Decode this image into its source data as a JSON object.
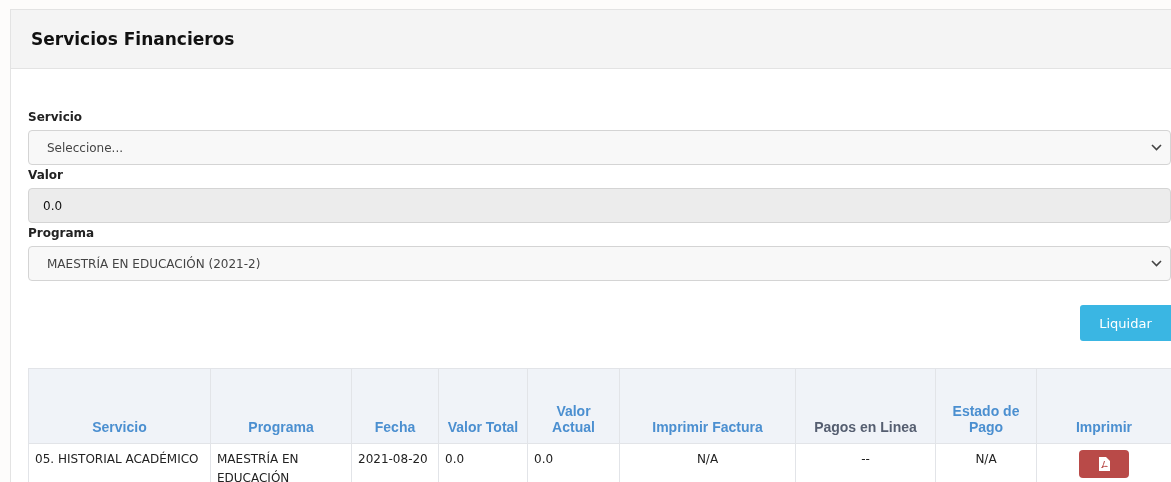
{
  "card": {
    "title": "Servicios Financieros"
  },
  "form": {
    "fields": [
      {
        "label": "Servicio",
        "kind": "select",
        "value": "Seleccione...",
        "disabled": false
      },
      {
        "label": "Valor",
        "kind": "text",
        "value": "0.0",
        "disabled": true
      },
      {
        "label": "Programa",
        "kind": "select",
        "value": "MAESTRÍA EN EDUCACIÓN (2021-2)",
        "disabled": false
      }
    ],
    "button": "Liquidar"
  },
  "table": {
    "columns": [
      {
        "label": "Servicio",
        "sortable": true
      },
      {
        "label": "Programa",
        "sortable": true
      },
      {
        "label": "Fecha",
        "sortable": true
      },
      {
        "label": "Valor Total",
        "sortable": true
      },
      {
        "label": "Valor Actual",
        "sortable": true
      },
      {
        "label": "Imprimir Factura",
        "sortable": true
      },
      {
        "label": "Pagos en Linea",
        "sortable": false
      },
      {
        "label": "Estado de Pago",
        "sortable": true
      },
      {
        "label": "Imprimir",
        "sortable": true
      }
    ],
    "rows": [
      {
        "cells": [
          {
            "kind": "text",
            "text": "05. HISTORIAL ACADÉMICO"
          },
          {
            "kind": "text",
            "text": "MAESTRÍA EN EDUCACIÓN"
          },
          {
            "kind": "text",
            "text": "2021-08-20"
          },
          {
            "kind": "text",
            "text": "0.0"
          },
          {
            "kind": "text",
            "text": "0.0"
          },
          {
            "kind": "center",
            "text": "N/A"
          },
          {
            "kind": "center",
            "text": "--"
          },
          {
            "kind": "center",
            "text": "N/A"
          },
          {
            "kind": "pdf"
          }
        ]
      }
    ]
  }
}
